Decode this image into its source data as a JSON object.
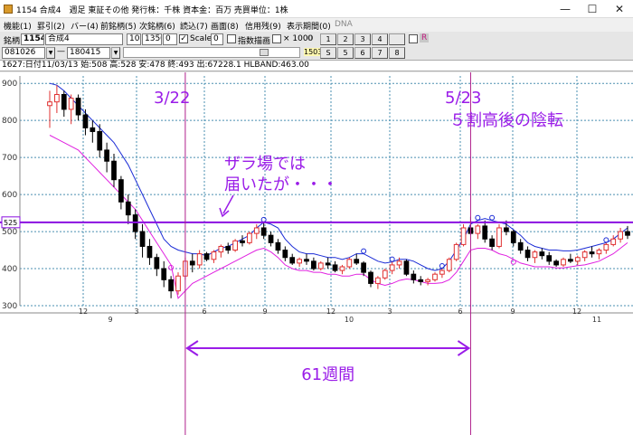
{
  "window": {
    "title": "1154 合成4　週足 東証その他 発行株：千株 資本金：百万 売買単位：1株",
    "min": "—",
    "max": "☐",
    "close": "✕"
  },
  "menu": [
    {
      "label": "機能(1)"
    },
    {
      "label": "罫引(2)"
    },
    {
      "label": "バー(4)"
    },
    {
      "label": "前銘柄(5)"
    },
    {
      "label": "次銘柄(6)"
    },
    {
      "label": "読込(7)"
    },
    {
      "label": "画面(8)"
    },
    {
      "label": "信用残(9)"
    },
    {
      "label": "表示期間(0)"
    },
    {
      "label": "DNA"
    }
  ],
  "toolbar1": {
    "code_label": "銘柄",
    "code": "1154",
    "name": "合成4",
    "period": "10",
    "scale_value": "1350",
    "scale_min": "0",
    "scale_label": "Scale",
    "scale_extra": "0",
    "log_label": "指数描画",
    "mult_label": "× 1000",
    "zero_label": "0",
    "nums": [
      "1",
      "2",
      "3",
      "4"
    ],
    "r_label": "R"
  },
  "toolbar2": {
    "date_from": "081026",
    "minus": "—",
    "date_to": "180415",
    "count": "1503",
    "nums": [
      "5",
      "6",
      "7",
      "8"
    ],
    "extra": "S"
  },
  "info": "1627:日付11/03/13  始:508  高:528  安:478  終:493  出:67228.1  HLBAND:463.00",
  "chart_data": {
    "type": "candlestick",
    "ylim": [
      300,
      920
    ],
    "yticks": [
      300,
      400,
      500,
      600,
      700,
      800,
      900
    ],
    "x_ticks": [
      "12",
      "3",
      "6",
      "9",
      "12",
      "3",
      "6",
      "9",
      "12"
    ],
    "x_years": [
      "9",
      "10",
      "11"
    ],
    "marker_price": 525,
    "candles": [
      [
        840,
        880,
        780,
        850
      ],
      [
        850,
        895,
        820,
        870
      ],
      [
        870,
        880,
        810,
        830
      ],
      [
        830,
        870,
        790,
        860
      ],
      [
        860,
        870,
        800,
        815
      ],
      [
        815,
        830,
        760,
        780
      ],
      [
        780,
        800,
        740,
        770
      ],
      [
        770,
        790,
        700,
        720
      ],
      [
        720,
        740,
        660,
        690
      ],
      [
        690,
        710,
        620,
        640
      ],
      [
        640,
        650,
        560,
        580
      ],
      [
        580,
        600,
        520,
        545
      ],
      [
        545,
        560,
        480,
        500
      ],
      [
        500,
        520,
        430,
        460
      ],
      [
        460,
        480,
        410,
        430
      ],
      [
        430,
        440,
        380,
        400
      ],
      [
        400,
        420,
        350,
        370
      ],
      [
        370,
        380,
        320,
        340
      ],
      [
        340,
        390,
        330,
        380
      ],
      [
        380,
        430,
        370,
        420
      ],
      [
        420,
        440,
        390,
        410
      ],
      [
        410,
        450,
        400,
        440
      ],
      [
        440,
        445,
        420,
        425
      ],
      [
        425,
        450,
        415,
        445
      ],
      [
        445,
        465,
        430,
        460
      ],
      [
        460,
        470,
        440,
        450
      ],
      [
        450,
        480,
        445,
        475
      ],
      [
        475,
        490,
        460,
        470
      ],
      [
        470,
        500,
        465,
        495
      ],
      [
        495,
        520,
        480,
        510
      ],
      [
        510,
        525,
        480,
        490
      ],
      [
        490,
        500,
        460,
        470
      ],
      [
        470,
        480,
        440,
        450
      ],
      [
        450,
        460,
        420,
        430
      ],
      [
        430,
        440,
        410,
        415
      ],
      [
        415,
        430,
        405,
        425
      ],
      [
        425,
        440,
        410,
        420
      ],
      [
        420,
        430,
        395,
        400
      ],
      [
        400,
        420,
        395,
        415
      ],
      [
        415,
        430,
        400,
        410
      ],
      [
        410,
        420,
        390,
        395
      ],
      [
        395,
        410,
        385,
        405
      ],
      [
        405,
        430,
        400,
        425
      ],
      [
        425,
        440,
        410,
        415
      ],
      [
        415,
        420,
        380,
        390
      ],
      [
        390,
        395,
        350,
        360
      ],
      [
        360,
        380,
        345,
        375
      ],
      [
        375,
        400,
        370,
        395
      ],
      [
        395,
        420,
        385,
        410
      ],
      [
        410,
        430,
        400,
        420
      ],
      [
        420,
        425,
        380,
        385
      ],
      [
        385,
        395,
        360,
        370
      ],
      [
        370,
        380,
        355,
        365
      ],
      [
        365,
        375,
        355,
        370
      ],
      [
        370,
        390,
        365,
        385
      ],
      [
        385,
        400,
        375,
        395
      ],
      [
        395,
        430,
        390,
        425
      ],
      [
        425,
        470,
        420,
        465
      ],
      [
        465,
        520,
        460,
        510
      ],
      [
        510,
        540,
        490,
        495
      ],
      [
        495,
        520,
        480,
        515
      ],
      [
        515,
        530,
        470,
        480
      ],
      [
        480,
        490,
        450,
        460
      ],
      [
        460,
        520,
        455,
        510
      ],
      [
        510,
        530,
        490,
        500
      ],
      [
        500,
        505,
        460,
        470
      ],
      [
        470,
        480,
        440,
        450
      ],
      [
        450,
        460,
        420,
        430
      ],
      [
        430,
        450,
        415,
        445
      ],
      [
        445,
        455,
        425,
        435
      ],
      [
        435,
        445,
        410,
        420
      ],
      [
        420,
        425,
        405,
        410
      ],
      [
        410,
        430,
        405,
        425
      ],
      [
        425,
        440,
        415,
        420
      ],
      [
        420,
        435,
        410,
        430
      ],
      [
        430,
        450,
        420,
        445
      ],
      [
        445,
        460,
        430,
        440
      ],
      [
        440,
        455,
        425,
        450
      ],
      [
        450,
        470,
        440,
        465
      ],
      [
        465,
        490,
        460,
        480
      ],
      [
        480,
        510,
        470,
        500
      ],
      [
        500,
        515,
        480,
        490
      ]
    ],
    "upper_band": [
      900,
      895,
      880,
      860,
      840,
      820,
      800,
      780,
      760,
      740,
      710,
      680,
      640,
      600,
      560,
      520,
      480,
      460,
      450,
      445,
      440,
      440,
      435,
      445,
      455,
      460,
      470,
      480,
      490,
      510,
      525,
      520,
      510,
      480,
      460,
      445,
      440,
      440,
      435,
      430,
      430,
      425,
      430,
      440,
      440,
      430,
      420,
      415,
      418,
      425,
      425,
      420,
      410,
      400,
      395,
      400,
      420,
      450,
      480,
      520,
      530,
      535,
      530,
      525,
      520,
      505,
      490,
      470,
      460,
      455,
      450,
      450,
      448,
      448,
      450,
      455,
      460,
      465,
      470,
      480,
      495,
      510
    ],
    "lower_band": [
      760,
      750,
      740,
      730,
      720,
      700,
      680,
      660,
      640,
      620,
      600,
      580,
      560,
      530,
      500,
      470,
      440,
      410,
      320,
      340,
      360,
      370,
      380,
      390,
      400,
      410,
      420,
      430,
      440,
      450,
      455,
      445,
      430,
      410,
      400,
      395,
      395,
      390,
      390,
      385,
      385,
      380,
      380,
      385,
      385,
      370,
      360,
      355,
      360,
      368,
      372,
      370,
      365,
      360,
      360,
      362,
      370,
      390,
      420,
      450,
      455,
      455,
      450,
      440,
      435,
      425,
      415,
      410,
      405,
      405,
      405,
      402,
      402,
      405,
      408,
      410,
      415,
      420,
      430,
      440,
      455,
      470
    ],
    "band_markers": [
      {
        "i": 17,
        "side": "lower"
      },
      {
        "i": 30,
        "side": "upper"
      },
      {
        "i": 44,
        "side": "upper"
      },
      {
        "i": 48,
        "side": "upper"
      },
      {
        "i": 55,
        "side": "upper"
      },
      {
        "i": 60,
        "side": "upper"
      },
      {
        "i": 62,
        "side": "upper"
      },
      {
        "i": 65,
        "side": "lower"
      },
      {
        "i": 78,
        "side": "upper"
      }
    ],
    "vlines": [
      {
        "i": 19,
        "label": "3/22"
      },
      {
        "i": 59,
        "label": "5/23"
      }
    ],
    "annotations": {
      "label_3_22": "3/22",
      "label_5_23": "5/23",
      "text_5_23": "５割高後の陰転",
      "text_zara_1": "ザラ場では",
      "text_zara_2": "届いたが・・・",
      "weeks": "61週間"
    },
    "colors": {
      "up": "#e03030",
      "down": "#000000",
      "upper_band": "#1a2bd6",
      "lower_band": "#e020e0",
      "annot": "#9a1ce8",
      "marker_line": "#8a10e0",
      "grid": "#4a8fb0",
      "vline": "#b0208c"
    }
  }
}
